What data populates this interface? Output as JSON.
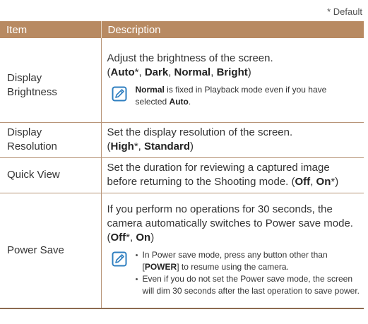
{
  "default_note": "* Default",
  "header": {
    "item": "Item",
    "description": "Description"
  },
  "rows": {
    "display_brightness": {
      "item": "Display Brightness",
      "desc_text": "Adjust the brightness of the screen.",
      "options": {
        "auto": "Auto",
        "dark": "Dark",
        "normal": "Normal",
        "bright": "Bright"
      },
      "note": {
        "normal": "Normal",
        "mid": " is fixed in Playback mode even if you have selected ",
        "auto": "Auto",
        "end": "."
      }
    },
    "display_resolution": {
      "item": "Display Resolution",
      "desc_text": "Set the display resolution of the screen.",
      "options": {
        "high": "High",
        "standard": "Standard"
      }
    },
    "quick_view": {
      "item": "Quick View",
      "desc_text": "Set the duration for reviewing a captured image before returning to the Shooting mode. ",
      "options": {
        "off": "Off",
        "on": "On"
      }
    },
    "power_save": {
      "item": "Power Save",
      "desc_text": "If you perform no operations for 30 seconds, the camera automatically switches to Power save mode. ",
      "options": {
        "off": "Off",
        "on": "On"
      },
      "notes": {
        "n1_start": "In Power save mode, press any button other than [",
        "n1_power": "POWER",
        "n1_end": "] to resume using the camera.",
        "n2": "Even if you do not set the Power save mode, the screen will dim 30 seconds after the last operation to save power."
      }
    }
  },
  "icons": {
    "note": "note-pencil-icon"
  },
  "colors": {
    "header_bg": "#b88a62",
    "rule": "#b89578",
    "icon": "#2f7fc0"
  }
}
